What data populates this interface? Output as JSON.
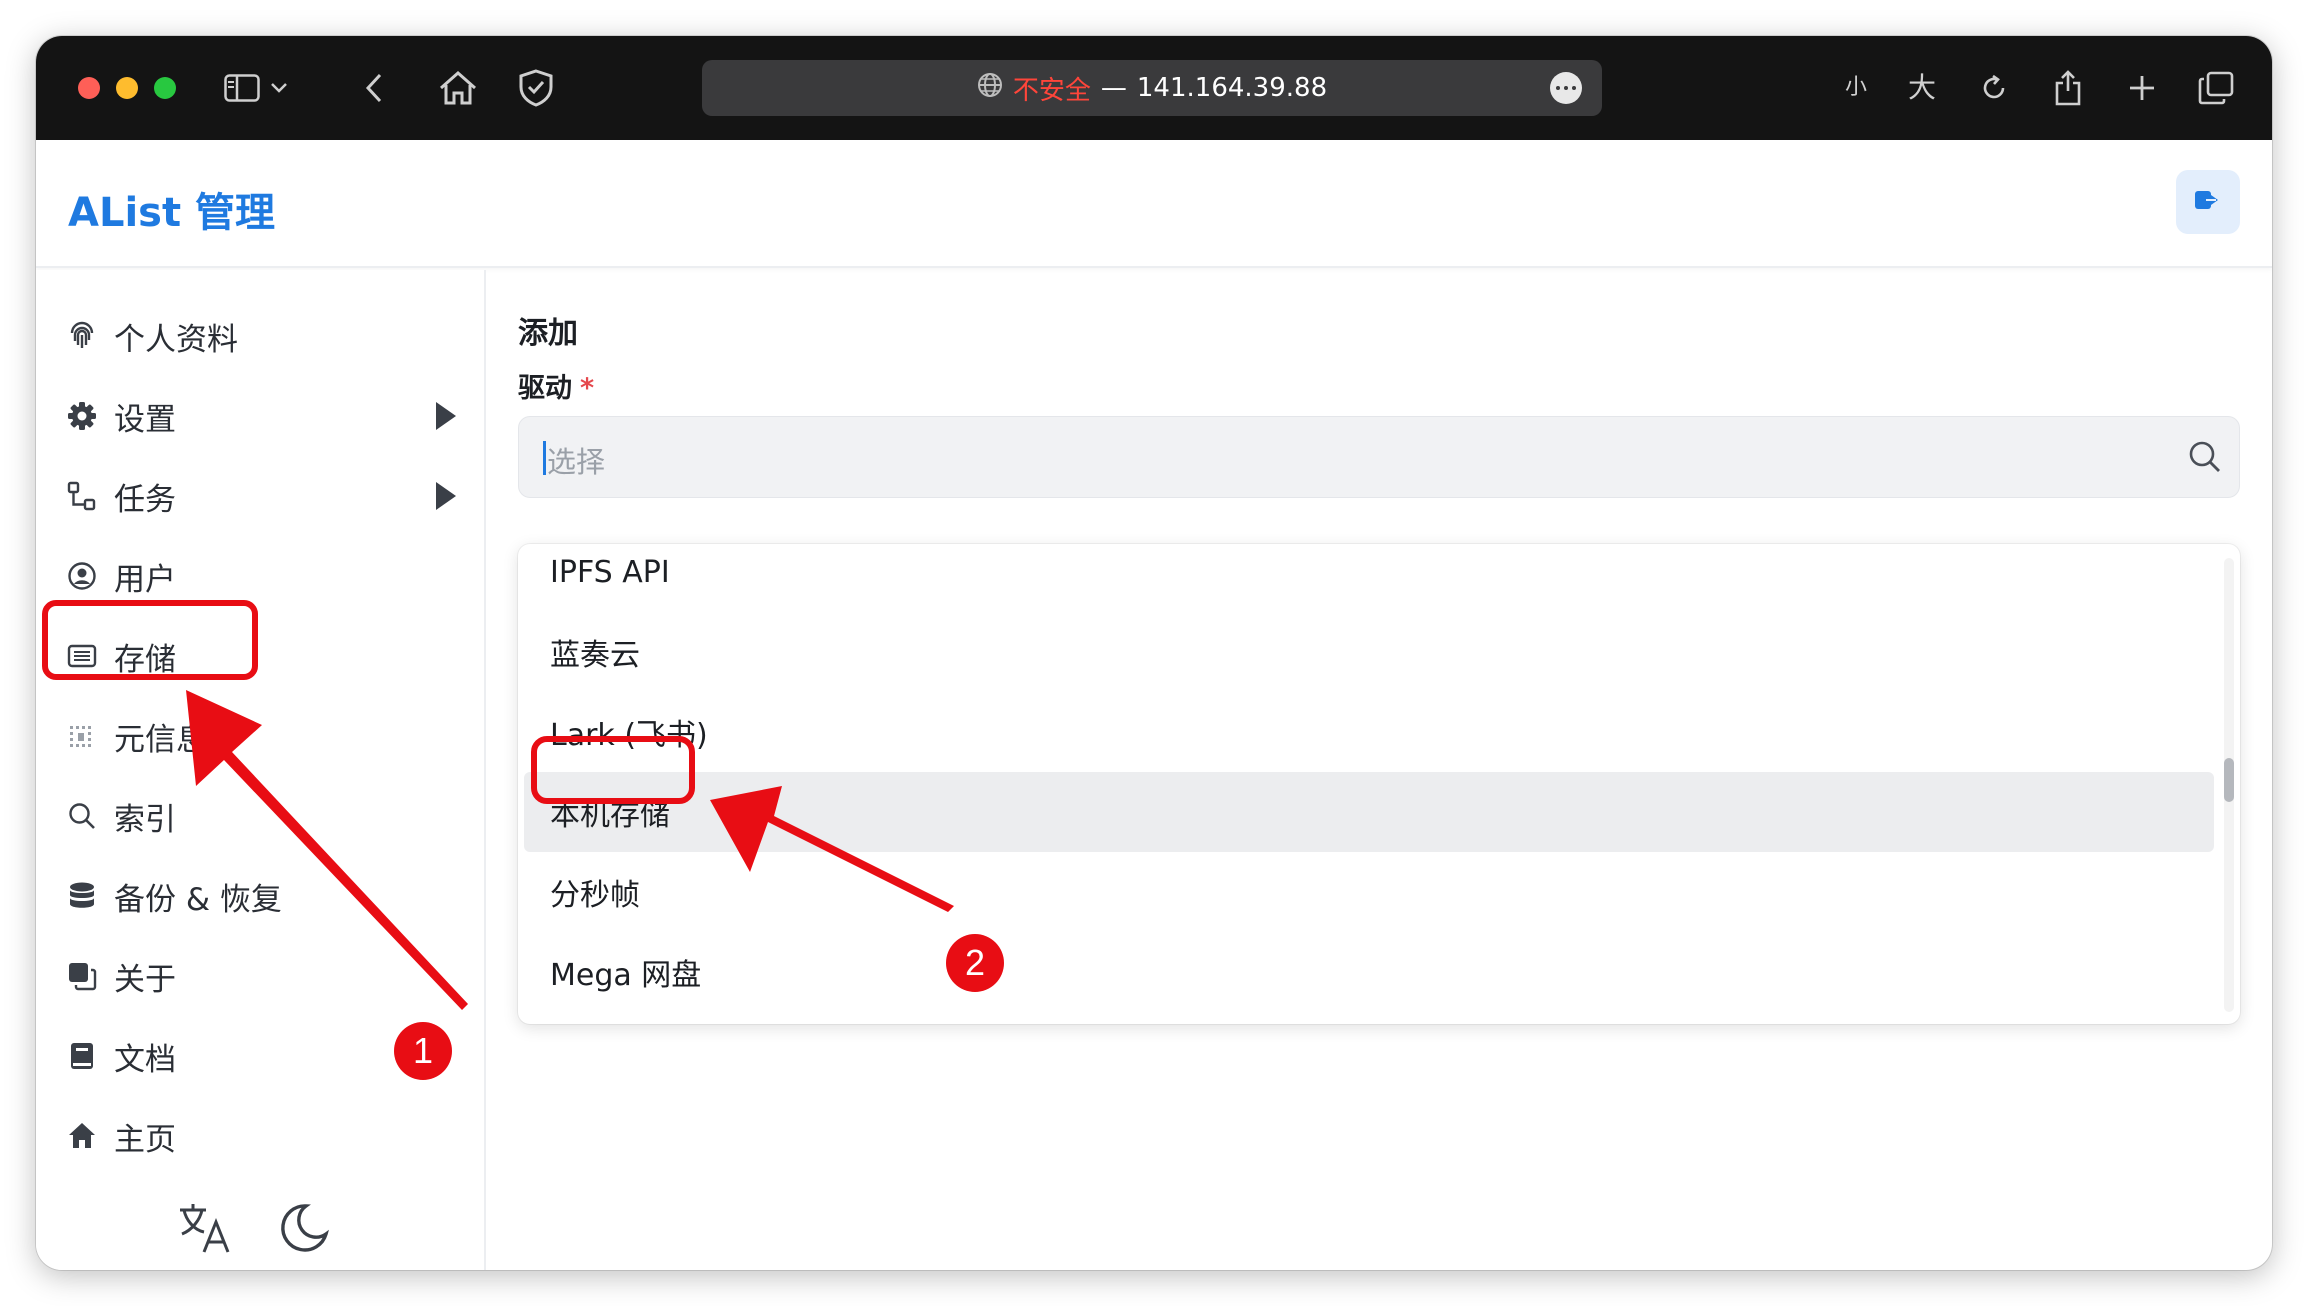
{
  "browser": {
    "url_warning": "不安全",
    "url_separator": "—",
    "url_host": "141.164.39.88",
    "text_smaller": "小",
    "text_larger": "大"
  },
  "app": {
    "title": "AList 管理"
  },
  "sidebar": {
    "items": [
      {
        "label": "个人资料",
        "icon": "fingerprint-icon",
        "has_submenu": false
      },
      {
        "label": "设置",
        "icon": "gear-icon",
        "has_submenu": true
      },
      {
        "label": "任务",
        "icon": "tasks-icon",
        "has_submenu": true
      },
      {
        "label": "用户",
        "icon": "user-circle-icon",
        "has_submenu": false
      },
      {
        "label": "存储",
        "icon": "storage-icon",
        "has_submenu": false
      },
      {
        "label": "元信息",
        "icon": "metadata-icon",
        "has_submenu": false
      },
      {
        "label": "索引",
        "icon": "search-icon",
        "has_submenu": false
      },
      {
        "label": "备份 & 恢复",
        "icon": "database-icon",
        "has_submenu": false
      },
      {
        "label": "关于",
        "icon": "copy-icon",
        "has_submenu": false
      },
      {
        "label": "文档",
        "icon": "book-icon",
        "has_submenu": false
      },
      {
        "label": "主页",
        "icon": "home-icon",
        "has_submenu": false
      }
    ]
  },
  "main": {
    "section_title": "添加",
    "driver_label": "驱动",
    "required_mark": "*",
    "select_placeholder": "选择",
    "options": [
      "IPFS API",
      "蓝奏云",
      "Lark (飞书)",
      "本机存储",
      "分秒帧",
      "Mega 网盘"
    ],
    "highlighted_option": "本机存储"
  },
  "annotations": {
    "step1": "1",
    "step2": "2",
    "color": "#e80d14"
  }
}
